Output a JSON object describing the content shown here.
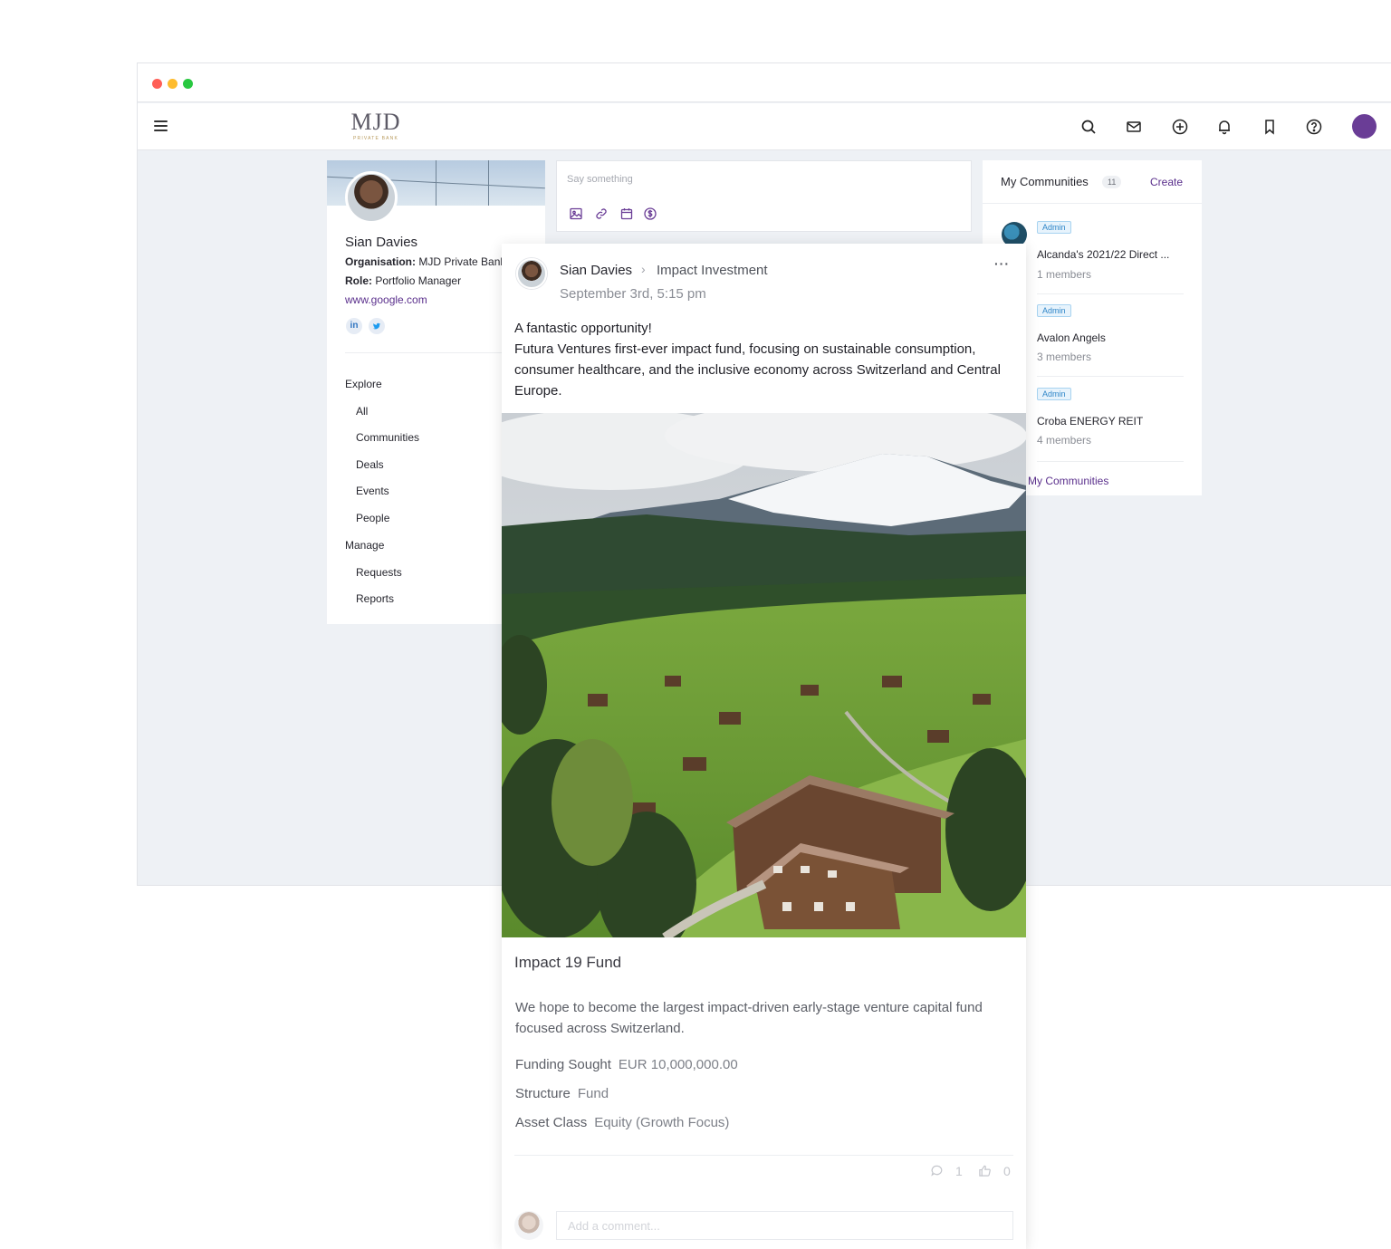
{
  "brand": {
    "logo_text": "MJD",
    "logo_sub": "PRIVATE BANK",
    "accent": "#5a2f8c"
  },
  "window": {
    "dots": [
      "#ff5f57",
      "#febc2e",
      "#28c840"
    ]
  },
  "navbar": {
    "icons": [
      "search-icon",
      "mail-icon",
      "plus-circle-icon",
      "bell-icon",
      "bookmark-icon",
      "help-icon"
    ],
    "avatar_color": "#6a3d96"
  },
  "profile": {
    "name": "Sian Davies",
    "organisation_label": "Organisation:",
    "organisation": "MJD Private Bank",
    "role_label": "Role:",
    "role": "Portfolio Manager",
    "website": "www.google.com",
    "social": [
      "in",
      "t"
    ],
    "menu": {
      "explore_label": "Explore",
      "explore_items": [
        "All",
        "Communities",
        "Deals",
        "Events",
        "People"
      ],
      "manage_label": "Manage",
      "manage_items": [
        "Requests",
        "Reports"
      ]
    }
  },
  "composer": {
    "placeholder": "Say something",
    "icons": [
      "image-icon",
      "link-icon",
      "calendar-icon",
      "dollar-icon"
    ]
  },
  "communities": {
    "title": "My Communities",
    "count": "11",
    "create_label": "Create",
    "items": [
      {
        "badge": "Admin",
        "name": "Alcanda's 2021/22 Direct ...",
        "members": "1 members"
      },
      {
        "badge": "Admin",
        "name": "Avalon Angels",
        "members": "3 members"
      },
      {
        "badge": "Admin",
        "name": "Croba ENERGY REIT",
        "members": "4 members"
      }
    ],
    "footer_link": "My Communities"
  },
  "post": {
    "author": "Sian Davies",
    "separator": "›",
    "group": "Impact Investment",
    "date": "September 3rd, 5:15 pm",
    "more": "···",
    "body_line1": "A fantastic opportunity!",
    "body_line2": "Futura Ventures first-ever impact fund, focusing on sustainable consumption, consumer healthcare, and the inclusive economy across Switzerland and Central Europe.",
    "deal": {
      "title": "Impact 19 Fund",
      "description": "We hope to become the largest impact-driven early-stage venture capital fund focused across Switzerland.",
      "funding_label": "Funding Sought",
      "funding_value": "EUR 10,000,000.00",
      "structure_label": "Structure",
      "structure_value": "Fund",
      "asset_label": "Asset Class",
      "asset_value": "Equity (Growth Focus)"
    },
    "comments_count": "1",
    "likes_count": "0",
    "comment_placeholder": "Add a comment..."
  }
}
